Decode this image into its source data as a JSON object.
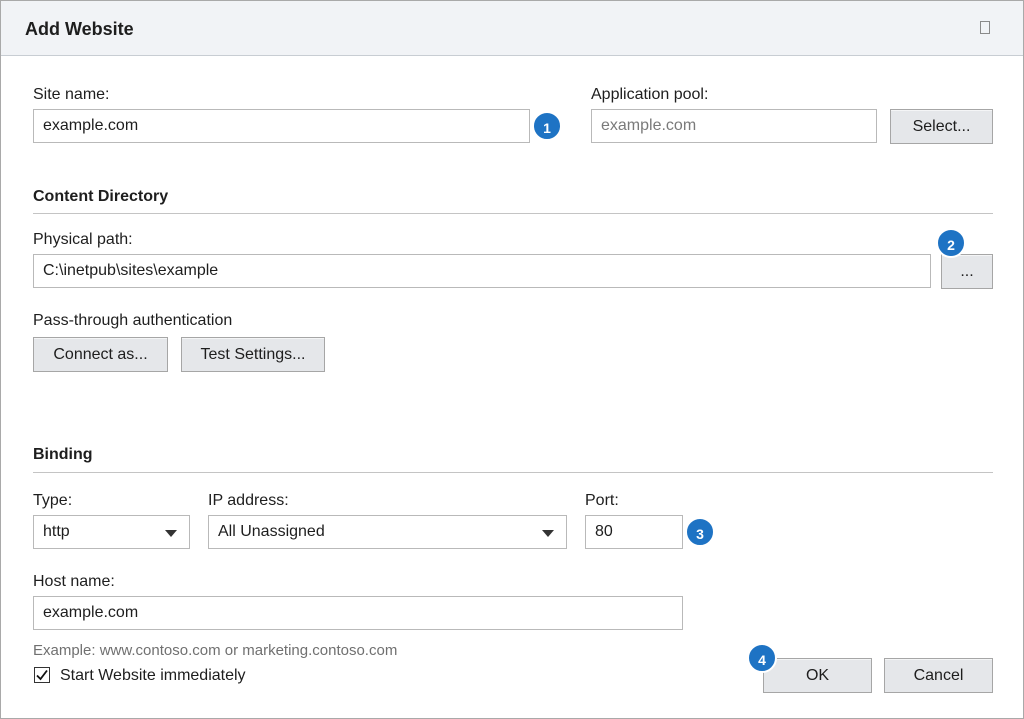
{
  "dialog": {
    "title": "Add Website",
    "title_icon": "restore-icon"
  },
  "site": {
    "site_name_label": "Site name:",
    "site_name_value": "example.com",
    "app_pool_label": "Application pool:",
    "app_pool_value": "example.com",
    "select_button": "Select..."
  },
  "content_directory": {
    "heading": "Content Directory",
    "physical_path_label": "Physical path:",
    "physical_path_value": "C:\\inetpub\\sites\\example",
    "browse_button": "...",
    "passthrough_label": "Pass-through authentication",
    "connect_as_button": "Connect as...",
    "test_settings_button": "Test Settings..."
  },
  "binding": {
    "heading": "Binding",
    "type_label": "Type:",
    "type_value": "http",
    "ip_label": "IP address:",
    "ip_value": "All Unassigned",
    "port_label": "Port:",
    "port_value": "80",
    "host_label": "Host name:",
    "host_value": "example.com",
    "example_hint": "Example: www.contoso.com or marketing.contoso.com"
  },
  "footer": {
    "start_checkbox_label": "Start Website immediately",
    "start_checked": true,
    "ok_button": "OK",
    "cancel_button": "Cancel"
  },
  "badges": [
    "1",
    "2",
    "3",
    "4"
  ],
  "colors": {
    "badge": "#1e73c4",
    "titlebar": "#f1f3f6",
    "button": "#e5e7ea"
  }
}
